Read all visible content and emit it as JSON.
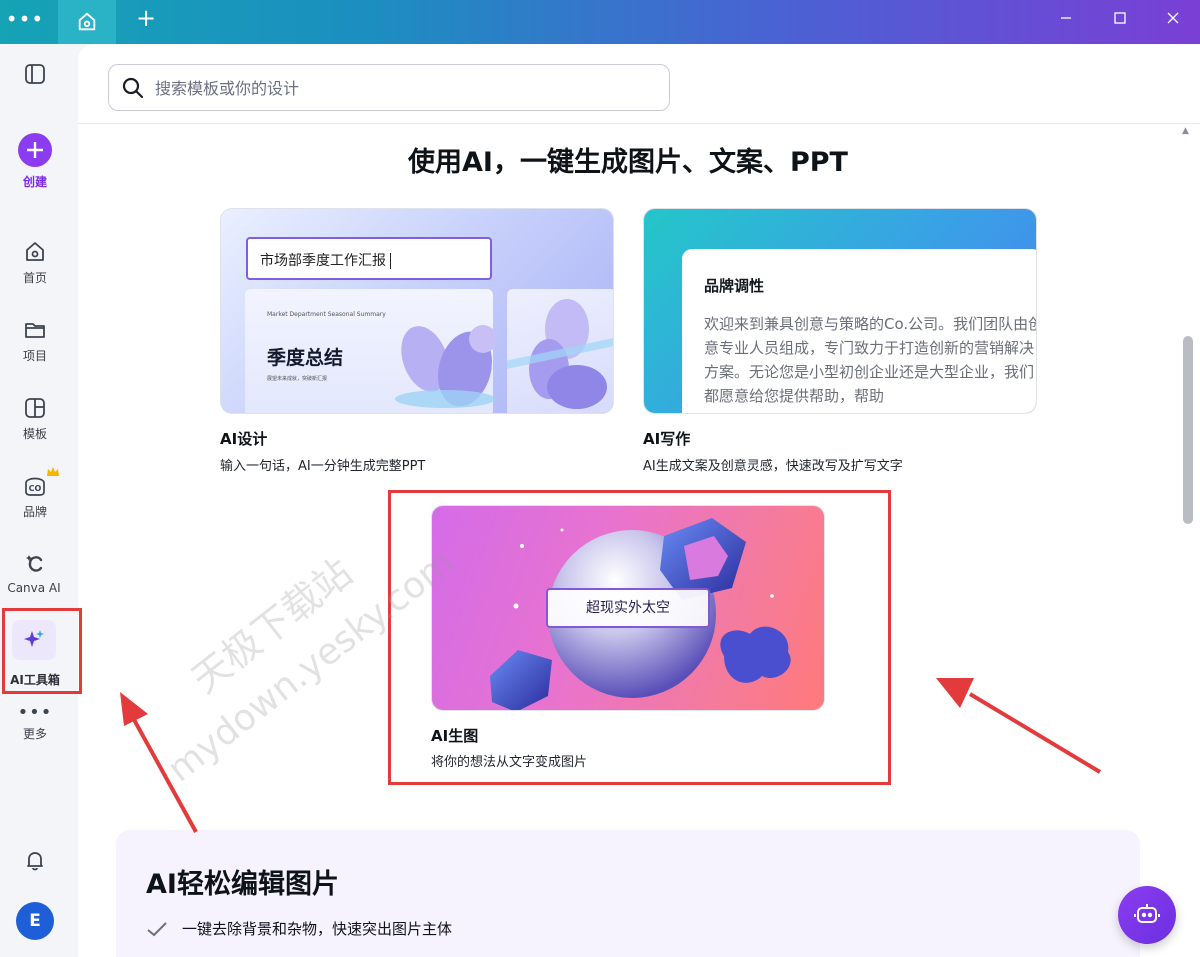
{
  "titlebar": {
    "new_tab_glyph": "+"
  },
  "sidebar": {
    "create_label": "创建",
    "items": [
      {
        "id": "home",
        "label": "首页",
        "icon": "home-icon"
      },
      {
        "id": "projects",
        "label": "项目",
        "icon": "folder-icon"
      },
      {
        "id": "templates",
        "label": "模板",
        "icon": "template-icon"
      },
      {
        "id": "brand",
        "label": "品牌",
        "icon": "brand-icon"
      },
      {
        "id": "canva-ai",
        "label": "Canva AI",
        "icon": "canva-ai-icon"
      },
      {
        "id": "ai-toolbox",
        "label": "AI工具箱",
        "icon": "sparkle-icon"
      },
      {
        "id": "more",
        "label": "更多",
        "icon": "more-icon"
      }
    ],
    "avatar_letter": "E"
  },
  "search": {
    "placeholder": "搜索模板或你的设计"
  },
  "main": {
    "heading": "使用AI，一键生成图片、文案、PPT",
    "cards": [
      {
        "title": "AI设计",
        "subtitle": "输入一句话，AI一分钟生成完整PPT",
        "input_text": "市场部季度工作汇报",
        "slide_small": "Market Department Seasonal Summary",
        "slide_title": "季度总结",
        "slide_sub": "展望未来成就，突破新汇报"
      },
      {
        "title": "AI写作",
        "subtitle": "AI生成文案及创意灵感，快速改写及扩写文字",
        "doc_title": "品牌调性",
        "doc_body": "欢迎来到兼具创意与策略的Co.公司。我们团队由创意专业人员组成，专门致力于打造创新的营销解决方案。无论您是小型初创企业还是大型企业，我们都愿意给您提供帮助，帮助"
      },
      {
        "title": "AI生图",
        "subtitle": "将你的想法从文字变成图片",
        "image_label": "超现实外太空"
      }
    ]
  },
  "edit_section": {
    "title": "AI轻松编辑图片",
    "items": [
      "一键去除背景和杂物，快速突出图片主体"
    ]
  },
  "watermark": {
    "line1": "天极下载站",
    "line2": "mydown.yesky.com"
  },
  "colors": {
    "accent": "#7d2ae8",
    "highlight": "#e33b3b"
  }
}
